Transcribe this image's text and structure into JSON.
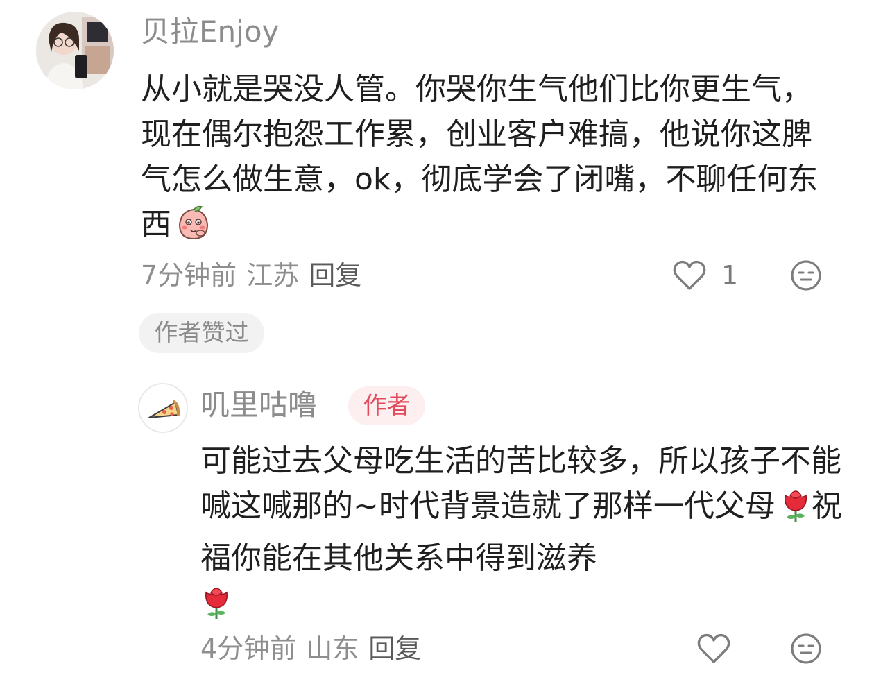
{
  "comments": [
    {
      "avatar_icon": "woman-selfie-avatar-icon",
      "username": "贝拉Enjoy",
      "text": "从小就是哭没人管。你哭你生气他们比你更生气，现在偶尔抱怨工作累，创业客户难搞，他说你这脾气怎么做生意，ok，彻底学会了闭嘴，不聊任何东西",
      "emoji_icon": "shy-peach-emoji-icon",
      "time": "7分钟前",
      "location": "江苏",
      "reply_label": "回复",
      "like_count": "1",
      "like_icon": "heart-icon",
      "dislike_icon": "meh-face-icon",
      "author_liked_label": "作者赞过"
    },
    {
      "avatar_icon": "pizza-slice-avatar-icon",
      "username": "叽里咕噜",
      "badge": "作者",
      "text_part1": "可能过去父母吃生活的苦比较多，所以孩子不能喊这喊那的~时代背景造就了那样一代父母",
      "text_part2": "祝福你能在其他关系中得到滋养",
      "emoji_icon": "rose-emoji-icon",
      "time": "4分钟前",
      "location": "山东",
      "reply_label": "回复",
      "like_icon": "heart-icon",
      "dislike_icon": "meh-face-icon"
    }
  ],
  "colors": {
    "username": "#8c8c8c",
    "body_text": "#1f1f1f",
    "meta": "#8e8e8e",
    "author_badge_text": "#e24b5b",
    "author_badge_bg": "#fdeef0",
    "liked_pill_bg": "#f2f2f2"
  }
}
